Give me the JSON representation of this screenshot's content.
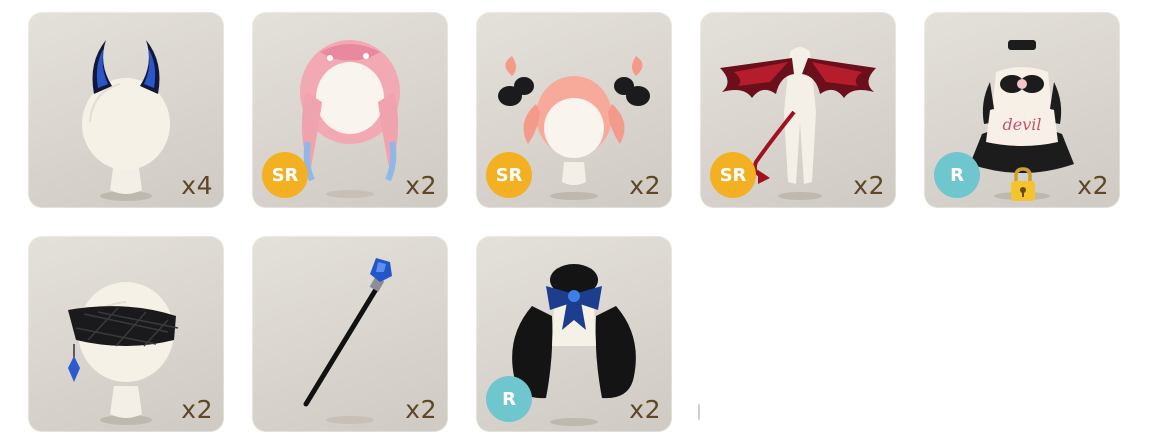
{
  "items": [
    {
      "name": "horns",
      "count": "x4",
      "rarity": ""
    },
    {
      "name": "pink-braids-hair",
      "count": "x2",
      "rarity": "SR"
    },
    {
      "name": "pink-twintail-hair",
      "count": "x2",
      "rarity": "SR"
    },
    {
      "name": "devil-wings-tail",
      "count": "x2",
      "rarity": "SR"
    },
    {
      "name": "devil-dress",
      "count": "x2",
      "rarity": "R",
      "locked": true
    },
    {
      "name": "lace-blindfold",
      "count": "x2",
      "rarity": ""
    },
    {
      "name": "crystal-staff",
      "count": "x2",
      "rarity": ""
    },
    {
      "name": "black-ribbon-hair",
      "count": "x2",
      "rarity": "R"
    }
  ],
  "colors": {
    "card_bg": "#d9d4ce",
    "count_text": "#5e4627",
    "sr_badge": "#f2b022",
    "r_badge": "#6fc6cf"
  },
  "dress_text": "devil"
}
